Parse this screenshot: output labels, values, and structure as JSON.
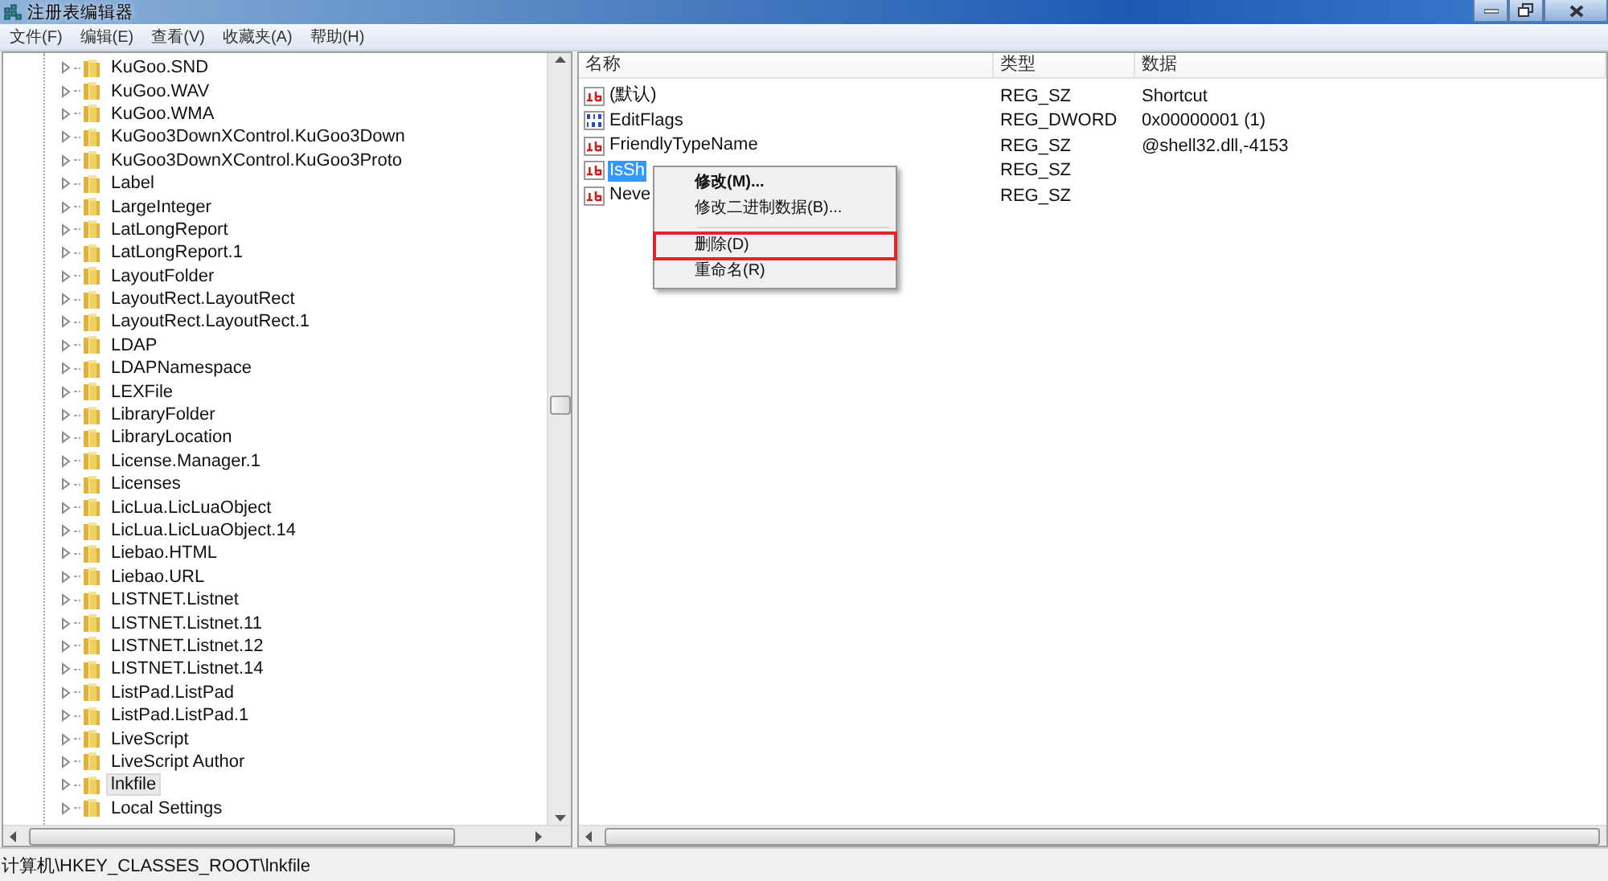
{
  "window": {
    "title": "注册表编辑器"
  },
  "menu": [
    "文件(F)",
    "编辑(E)",
    "查看(V)",
    "收藏夹(A)",
    "帮助(H)"
  ],
  "tree": {
    "items": [
      {
        "label": "KuGoo.SND",
        "selected": false
      },
      {
        "label": "KuGoo.WAV",
        "selected": false
      },
      {
        "label": "KuGoo.WMA",
        "selected": false
      },
      {
        "label": "KuGoo3DownXControl.KuGoo3Down",
        "selected": false
      },
      {
        "label": "KuGoo3DownXControl.KuGoo3Proto",
        "selected": false
      },
      {
        "label": "Label",
        "selected": false
      },
      {
        "label": "LargeInteger",
        "selected": false
      },
      {
        "label": "LatLongReport",
        "selected": false
      },
      {
        "label": "LatLongReport.1",
        "selected": false
      },
      {
        "label": "LayoutFolder",
        "selected": false
      },
      {
        "label": "LayoutRect.LayoutRect",
        "selected": false
      },
      {
        "label": "LayoutRect.LayoutRect.1",
        "selected": false
      },
      {
        "label": "LDAP",
        "selected": false
      },
      {
        "label": "LDAPNamespace",
        "selected": false
      },
      {
        "label": "LEXFile",
        "selected": false
      },
      {
        "label": "LibraryFolder",
        "selected": false
      },
      {
        "label": "LibraryLocation",
        "selected": false
      },
      {
        "label": "License.Manager.1",
        "selected": false
      },
      {
        "label": "Licenses",
        "selected": false
      },
      {
        "label": "LicLua.LicLuaObject",
        "selected": false
      },
      {
        "label": "LicLua.LicLuaObject.14",
        "selected": false
      },
      {
        "label": "Liebao.HTML",
        "selected": false
      },
      {
        "label": "Liebao.URL",
        "selected": false
      },
      {
        "label": "LISTNET.Listnet",
        "selected": false
      },
      {
        "label": "LISTNET.Listnet.11",
        "selected": false
      },
      {
        "label": "LISTNET.Listnet.12",
        "selected": false
      },
      {
        "label": "LISTNET.Listnet.14",
        "selected": false
      },
      {
        "label": "ListPad.ListPad",
        "selected": false
      },
      {
        "label": "ListPad.ListPad.1",
        "selected": false
      },
      {
        "label": "LiveScript",
        "selected": false
      },
      {
        "label": "LiveScript Author",
        "selected": false
      },
      {
        "label": "lnkfile",
        "selected": true
      },
      {
        "label": "Local Settings",
        "selected": false
      }
    ]
  },
  "table": {
    "columns": [
      "名称",
      "类型",
      "数据"
    ],
    "rows": [
      {
        "kind": "string",
        "name": "(默认)",
        "type": "REG_SZ",
        "data": "Shortcut",
        "selected": false
      },
      {
        "kind": "dword",
        "name": "EditFlags",
        "type": "REG_DWORD",
        "data": "0x00000001 (1)",
        "selected": false
      },
      {
        "kind": "string",
        "name": "FriendlyTypeName",
        "type": "REG_SZ",
        "data": "@shell32.dll,-4153",
        "selected": false
      },
      {
        "kind": "string",
        "name": "IsSh",
        "type": "REG_SZ",
        "selected": true
      },
      {
        "kind": "string",
        "name": "Neve",
        "type": "REG_SZ",
        "selected": false
      }
    ]
  },
  "context_menu": {
    "items": [
      {
        "label": "修改(M)...",
        "default": true,
        "highlighted": false
      },
      {
        "label": "修改二进制数据(B)...",
        "default": false,
        "highlighted": false
      },
      {
        "kind": "separator"
      },
      {
        "label": "删除(D)",
        "default": false,
        "highlighted": true
      },
      {
        "label": "重命名(R)",
        "default": false,
        "highlighted": false
      }
    ]
  },
  "status_bar": "计算机\\HKEY_CLASSES_ROOT\\lnkfile"
}
